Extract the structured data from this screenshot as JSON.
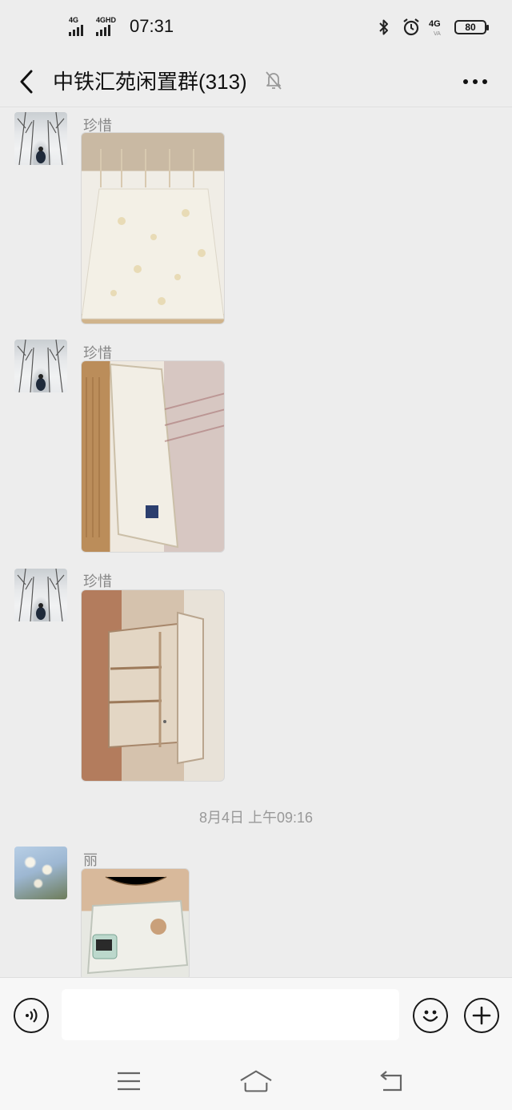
{
  "status_bar": {
    "signal1_label": "4G",
    "signal2_label": "4GHD",
    "time": "07:31",
    "bluetooth_icon": "bluetooth-icon",
    "alarm_icon": "alarm-icon",
    "network_label": "4G",
    "network_sub": "VA",
    "battery_level": "80"
  },
  "header": {
    "title": "中铁汇苑闲置群(313)",
    "back_icon": "chevron-left-icon",
    "mute_icon": "bell-off-icon",
    "more_icon": "more-dots-icon"
  },
  "messages": [
    {
      "sender": "珍惜",
      "avatar": "snow-forest-avatar",
      "image": "mattress-on-bed-photo"
    },
    {
      "sender": "珍惜",
      "avatar": "snow-forest-avatar",
      "image": "mattress-standing-photo"
    },
    {
      "sender": "珍惜",
      "avatar": "snow-forest-avatar",
      "image": "wooden-cabinet-photo"
    },
    {
      "timestamp": "8月4日 上午09:16"
    },
    {
      "sender": "丽",
      "avatar": "magnolia-flower-avatar",
      "image": "printer-photo"
    }
  ],
  "input_bar": {
    "voice_icon": "voice-icon",
    "input_value": "",
    "emoji_icon": "emoji-icon",
    "plus_icon": "plus-icon"
  },
  "nav_bar": {
    "menu_icon": "menu-icon",
    "home_icon": "home-icon",
    "back_icon": "back-arrow-icon"
  },
  "colors": {
    "background": "#ededed",
    "input_bar_bg": "#f7f7f7",
    "sender_text": "#888888"
  }
}
